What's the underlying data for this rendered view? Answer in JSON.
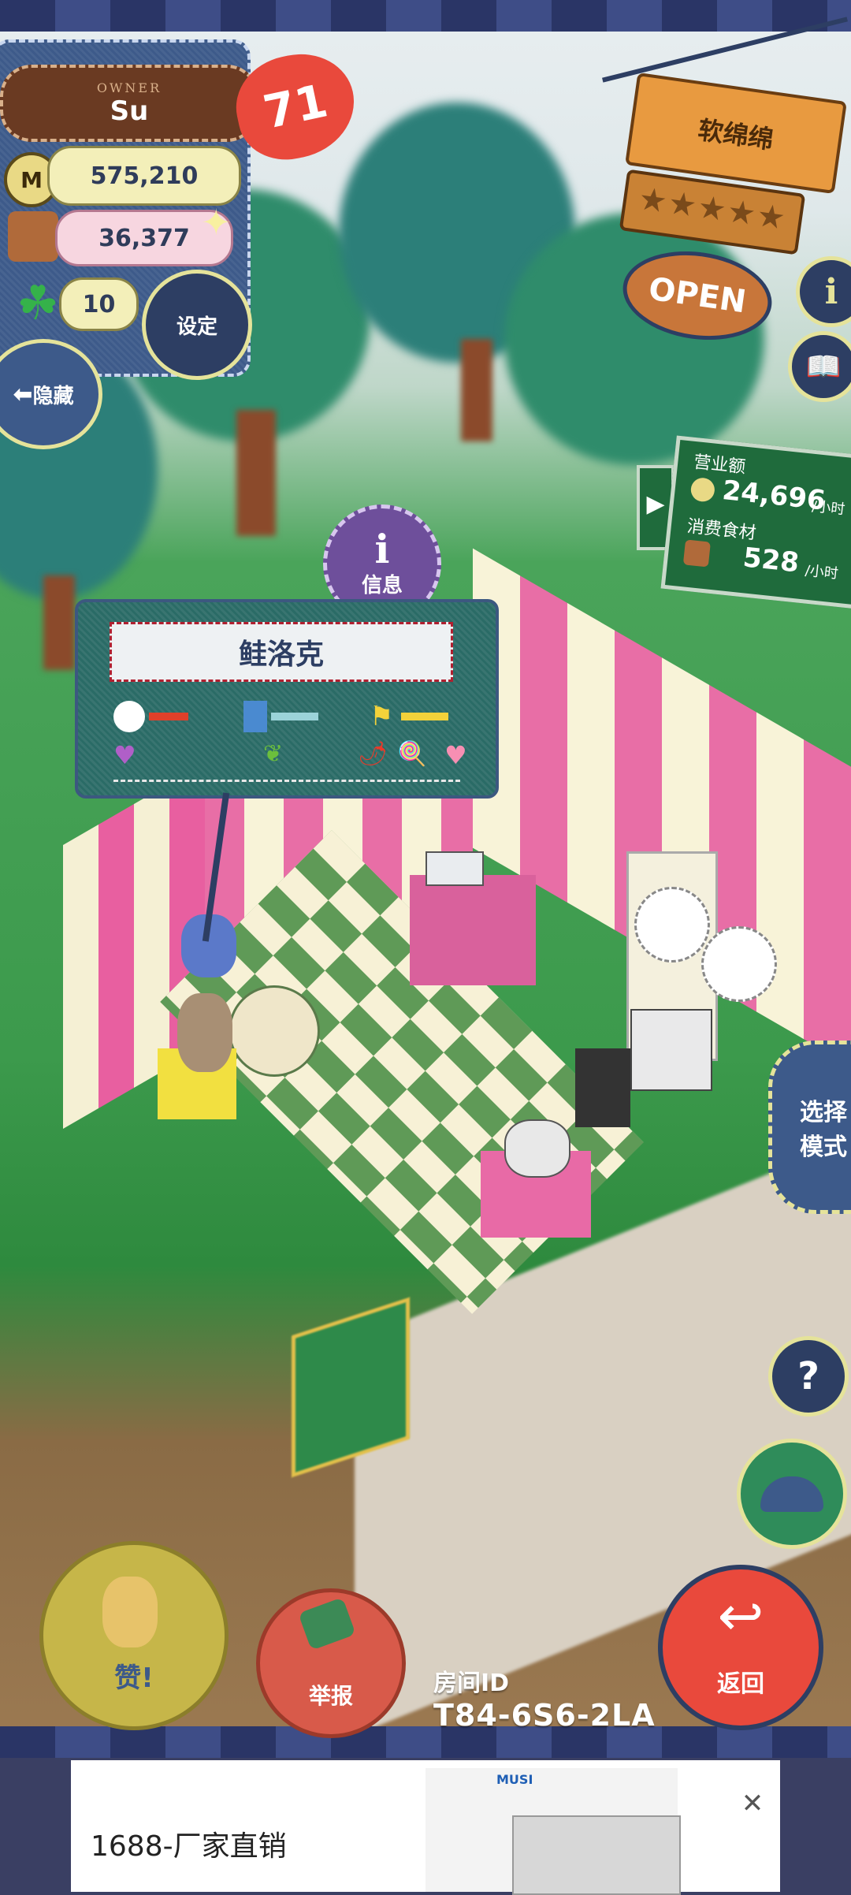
{
  "owner": {
    "caption": "OWNER",
    "name": "Su",
    "coins": "575,210",
    "ingredients": "36,377",
    "clovers": "10",
    "level": "71",
    "settings_label": "设定",
    "hide_label": "隐藏"
  },
  "shop": {
    "name": "软绵绵",
    "open_label": "OPEN"
  },
  "stats": {
    "revenue_label": "营业额",
    "revenue_value": "24,696",
    "consumption_label": "消费食材",
    "consumption_value": "528",
    "per_hour": "/小时"
  },
  "character": {
    "info_label": "信息",
    "name": "鲑洛克"
  },
  "mode_button_label": "选择模式",
  "help_label": "?",
  "room": {
    "id_label": "房间ID",
    "id_value": "T84-6S6-2LA"
  },
  "bottom": {
    "like_label": "赞!",
    "report_label": "举报",
    "back_label": "返回"
  },
  "ad": {
    "text": "1688-厂家直销",
    "brand": "MUSI",
    "close_label": "✕"
  },
  "colors": {
    "accent_red": "#e9493c",
    "denim": "#3d5a8a",
    "board_green": "#1f6b3c"
  }
}
